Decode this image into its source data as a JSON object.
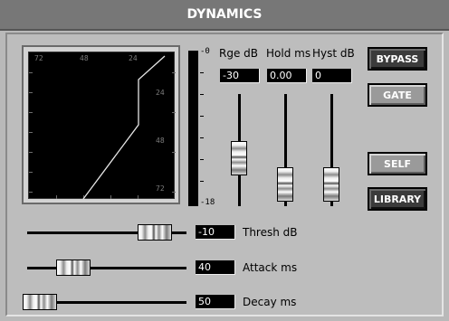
{
  "title": "DYNAMICS",
  "graph": {
    "x_ticks": [
      "72",
      "48",
      "24"
    ],
    "y_ticks": [
      "24",
      "48",
      "72"
    ],
    "meter_top": "-0",
    "meter_bottom": "-18"
  },
  "params": {
    "range": {
      "label": "Rge dB",
      "value": "-30",
      "level": 0.3
    },
    "hold": {
      "label": "Hold ms",
      "value": "0.00",
      "level": 0.0
    },
    "hyst": {
      "label": "Hyst dB",
      "value": "0",
      "level": 0.0
    }
  },
  "horizontal": {
    "thresh": {
      "label": "Thresh dB",
      "value": "-10",
      "level": 0.75
    },
    "attack": {
      "label": "Attack ms",
      "value": "40",
      "level": 0.22
    },
    "decay": {
      "label": "Decay ms",
      "value": "50",
      "level": 0.0
    }
  },
  "buttons": {
    "bypass": "BYPASS",
    "gate": "GATE",
    "self": "SELF",
    "library": "LIBRARY"
  }
}
